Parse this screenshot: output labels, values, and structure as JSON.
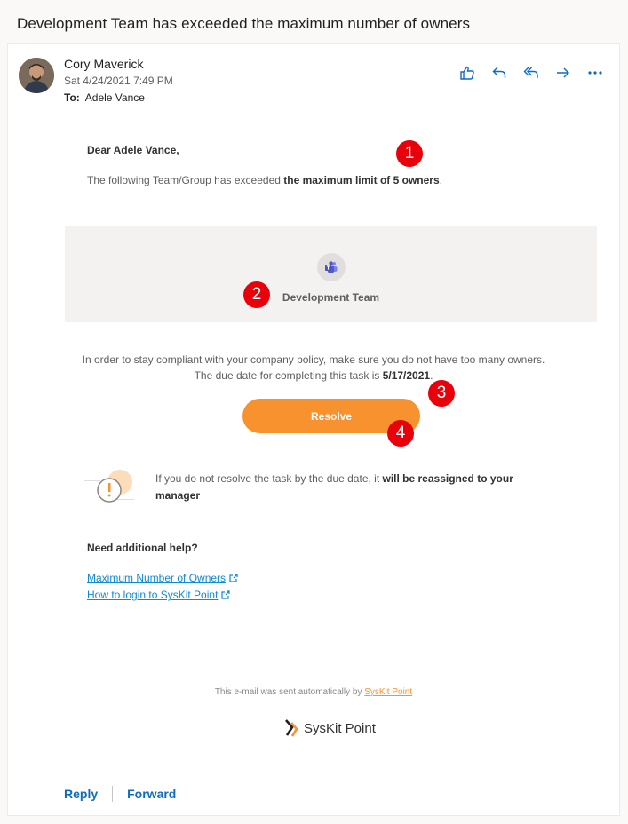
{
  "message": {
    "subject": "Development Team has exceeded the maximum number of owners",
    "sender": "Cory Maverick",
    "date": "Sat 4/24/2021 7:49 PM",
    "to_label": "To:",
    "to": "Adele Vance"
  },
  "toolbar": {
    "icons": [
      "like-icon",
      "reply-icon",
      "reply-all-icon",
      "forward-icon",
      "more-icon"
    ],
    "accent": "#0f6cbd"
  },
  "body": {
    "greeting": "Dear Adele Vance,",
    "intro_text": "The following Team/Group has exceeded ",
    "intro_bold": "the maximum limit of 5 owners",
    "intro_end": ".",
    "team_name": "Development Team",
    "policy_line1": "In order to stay compliant with your company policy, make sure you do not have too many owners.",
    "policy_line2": "The due date for completing this task is ",
    "due_date": "5/17/2021",
    "policy_end": ".",
    "resolve_label": "Resolve",
    "warning_text": "If you do not resolve the task by the due date, it ",
    "warning_bold": "will be reassigned to your manager",
    "help_title": "Need additional help?",
    "help_links": [
      "Maximum Number of Owners",
      "How to login to SysKit Point"
    ],
    "footer_text": "This e-mail was sent automatically by ",
    "footer_link": "SysKit Point",
    "logo_text": "SysKit Point",
    "brand_color": "#f7922e"
  },
  "markers": [
    "1",
    "2",
    "3",
    "4"
  ],
  "reply_bar": {
    "reply": "Reply",
    "forward": "Forward"
  }
}
